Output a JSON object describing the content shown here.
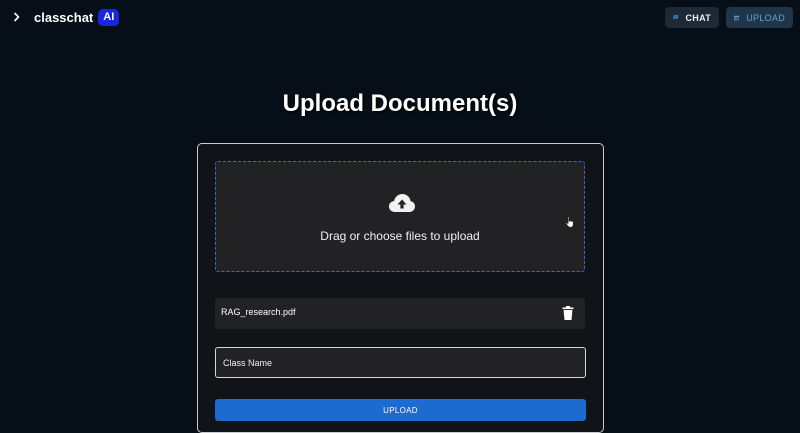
{
  "header": {
    "brand_name": "classchat",
    "brand_badge": "AI",
    "nav": {
      "chat_label": "CHAT",
      "upload_label": "UPLOAD"
    }
  },
  "main": {
    "title": "Upload Document(s)",
    "dropzone": {
      "text": "Drag or choose files to upload"
    },
    "files": [
      {
        "name": "RAG_research.pdf"
      }
    ],
    "class_name_field": {
      "value": "",
      "placeholder": "Class Name"
    },
    "submit_label": "UPLOAD"
  },
  "colors": {
    "background": "#060f17",
    "brand_badge": "#1a25e0",
    "accent": "#1b6bd1",
    "dropzone_border": "#2f6fd6",
    "active_nav_text": "#5da2de"
  },
  "icons": {
    "expand": "chevron-right-icon",
    "chat": "chat-bubble-icon",
    "upload": "upload-panel-icon",
    "dropzone": "cloud-upload-icon",
    "delete": "trash-icon"
  }
}
